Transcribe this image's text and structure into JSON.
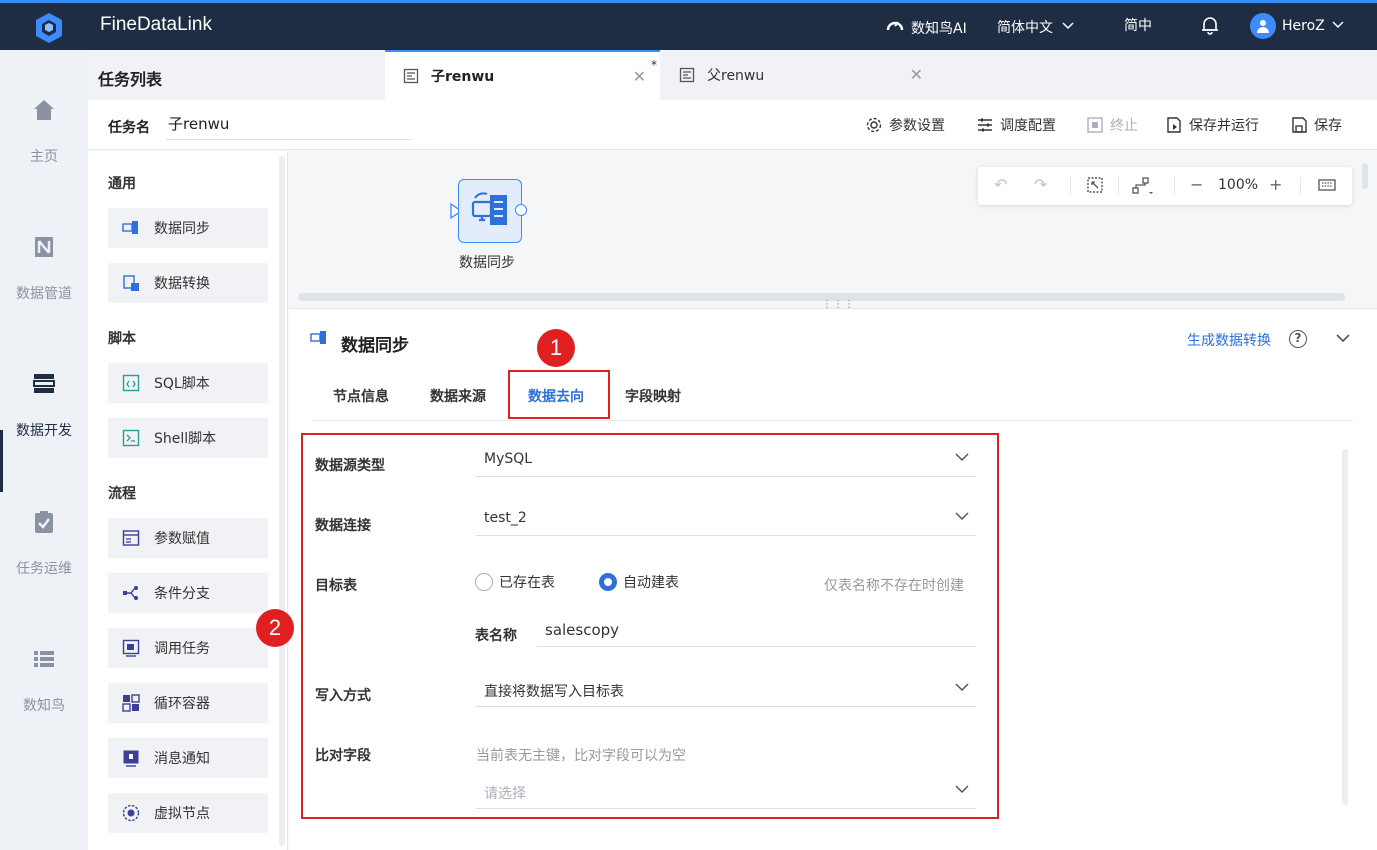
{
  "app": {
    "title": "FineDataLink"
  },
  "topbar": {
    "ai_label": "数知鸟AI",
    "language": "简体中文",
    "simplified": "简中",
    "user": "HeroZ"
  },
  "leftnav": {
    "items": [
      {
        "label": "主页",
        "icon": "home-icon"
      },
      {
        "label": "数据管道",
        "icon": "pipeline-icon"
      },
      {
        "label": "数据开发",
        "icon": "dev-icon"
      },
      {
        "label": "任务运维",
        "icon": "ops-icon"
      },
      {
        "label": "数知鸟",
        "icon": "list-icon"
      }
    ]
  },
  "tasklist": {
    "title": "任务列表"
  },
  "tabs": [
    {
      "label": "子renwu",
      "modified": "*"
    },
    {
      "label": "父renwu"
    }
  ],
  "taskname": {
    "label": "任务名",
    "value": "子renwu"
  },
  "toolbar": {
    "params": "参数设置",
    "schedule": "调度配置",
    "stop": "终止",
    "save_run": "保存并运行",
    "save": "保存"
  },
  "palette": {
    "groups": [
      {
        "title": "通用",
        "items": [
          "数据同步",
          "数据转换"
        ]
      },
      {
        "title": "脚本",
        "items": [
          "SQL脚本",
          "Shell脚本"
        ]
      },
      {
        "title": "流程",
        "items": [
          "参数赋值",
          "条件分支",
          "调用任务",
          "循环容器",
          "消息通知",
          "虚拟节点"
        ]
      }
    ]
  },
  "canvas": {
    "node_label": "数据同步",
    "zoom": "100%"
  },
  "props": {
    "title": "数据同步",
    "link": "生成数据转换",
    "help": "?",
    "tabs": [
      "节点信息",
      "数据来源",
      "数据去向",
      "字段映射"
    ],
    "active_tab": "数据去向",
    "badges": [
      "1",
      "2"
    ],
    "form": {
      "source_type_label": "数据源类型",
      "source_type_value": "MySQL",
      "connection_label": "数据连接",
      "connection_value": "test_2",
      "target_label": "目标表",
      "radio_existing": "已存在表",
      "radio_auto": "自动建表",
      "target_hint": "仅表名称不存在时创建",
      "tablename_label": "表名称",
      "tablename_value": "salescopy",
      "write_label": "写入方式",
      "write_value": "直接将数据写入目标表",
      "compare_label": "比对字段",
      "compare_hint": "当前表无主键，比对字段可以为空",
      "compare_placeholder": "请选择"
    }
  },
  "colors": {
    "topbar": "#1e2d44",
    "accent": "#3d8bfd",
    "link": "#2f6fdc",
    "highlight": "#e02020"
  }
}
